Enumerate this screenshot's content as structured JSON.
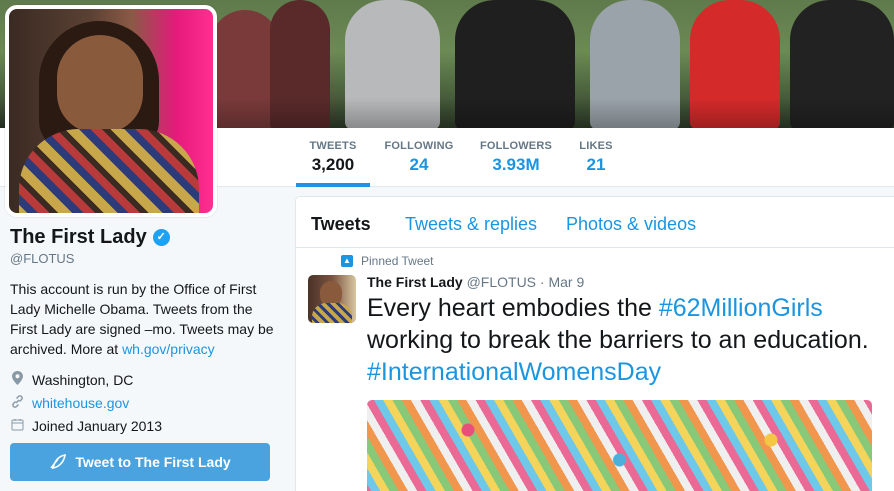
{
  "banner": {
    "description_colors": [
      "#5f7a4c",
      "#2f3e2a"
    ]
  },
  "nav": {
    "stats": [
      {
        "label": "TWEETS",
        "value": "3,200",
        "active": true
      },
      {
        "label": "FOLLOWING",
        "value": "24"
      },
      {
        "label": "FOLLOWERS",
        "value": "3.93M"
      },
      {
        "label": "LIKES",
        "value": "21"
      }
    ]
  },
  "profile": {
    "name": "The First Lady",
    "verified_icon": "✓",
    "handle": "@FLOTUS",
    "bio_text": "This account is run by the Office of First Lady Michelle Obama. Tweets from the First Lady are signed –mo. Tweets may be archived. More at ",
    "bio_link": "wh.gov/privacy",
    "location": "Washington, DC",
    "website": "whitehouse.gov",
    "joined": "Joined January 2013",
    "tweet_button": "Tweet to The First Lady"
  },
  "timeline": {
    "tabs": [
      "Tweets",
      "Tweets & replies",
      "Photos & videos"
    ],
    "pinned_label": "Pinned Tweet",
    "tweet": {
      "name": "The First Lady",
      "handle": "@FLOTUS",
      "dot": "·",
      "date": "Mar 9",
      "text_1": "Every heart embodies the ",
      "hashtag_1": "#62MillionGirls",
      "text_2": " working to break the barriers to an education. ",
      "hashtag_2": "#InternationalWomensDay"
    }
  },
  "colors": {
    "accent": "#1b95e0",
    "button": "#4aa3df",
    "verified": "#1da1f2"
  }
}
